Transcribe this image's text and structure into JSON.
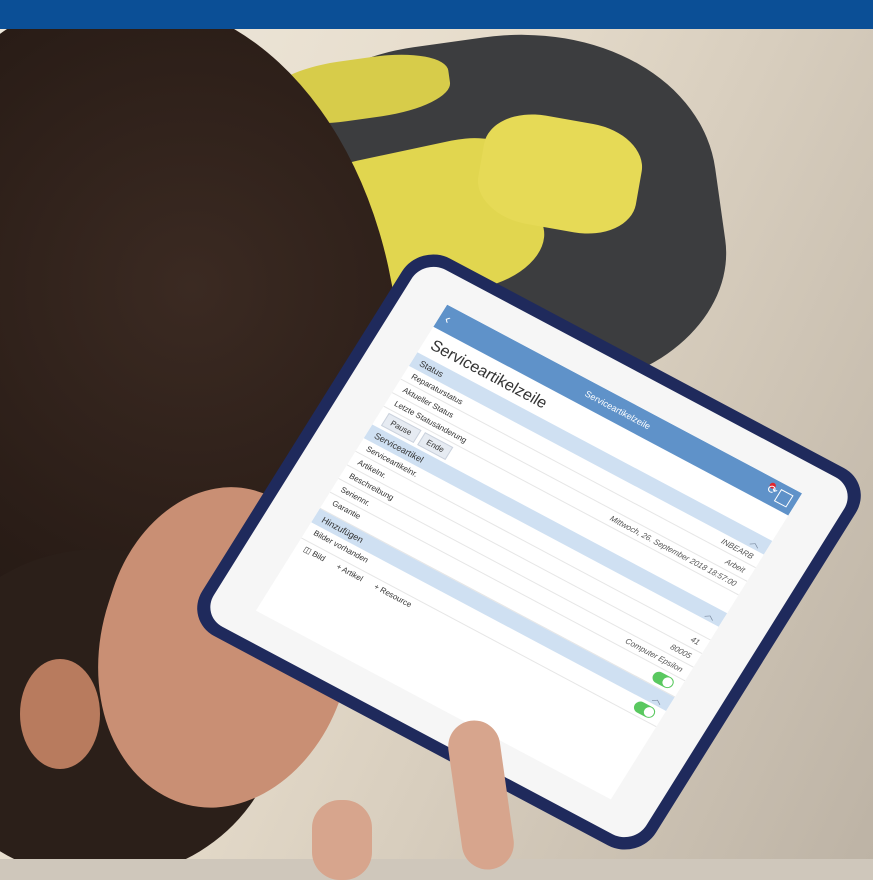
{
  "app": {
    "screen_title": "Serviceartikelzeile",
    "headline": "Serviceartikelzeile"
  },
  "sections": {
    "status": {
      "title": "Status",
      "rows": [
        {
          "label": "Reparaturstatus",
          "value": "INBEARB"
        },
        {
          "label": "Aktueller Status",
          "value": "Arbeit"
        },
        {
          "label": "Letzte Statusänderung",
          "value": "Mittwoch, 26. September 2018 18:57:00"
        }
      ],
      "actions": {
        "pause": "Pause",
        "end": "Ende"
      }
    },
    "serviceartikel": {
      "title": "Serviceartikel",
      "rows": [
        {
          "label": "Serviceartikelnr.",
          "value": ""
        },
        {
          "label": "Artikelnr.",
          "value": "41"
        },
        {
          "label": "Beschreibung",
          "value": "80005"
        },
        {
          "label": "Seriennr.",
          "value": "Computer Epsilon"
        },
        {
          "label": "Garantie",
          "value": ""
        }
      ]
    },
    "hinzufuegen": {
      "title": "Hinzufügen",
      "images_label": "Bilder vorhanden",
      "items": {
        "bild": "Bild",
        "artikel": "Artikel",
        "resource": "Resource"
      }
    }
  },
  "colors": {
    "topbar": "#0b4f96",
    "nav": "#5f92c9",
    "section": "#cfe0f2",
    "toggle": "#59c85f",
    "badge": "#e2242c"
  }
}
